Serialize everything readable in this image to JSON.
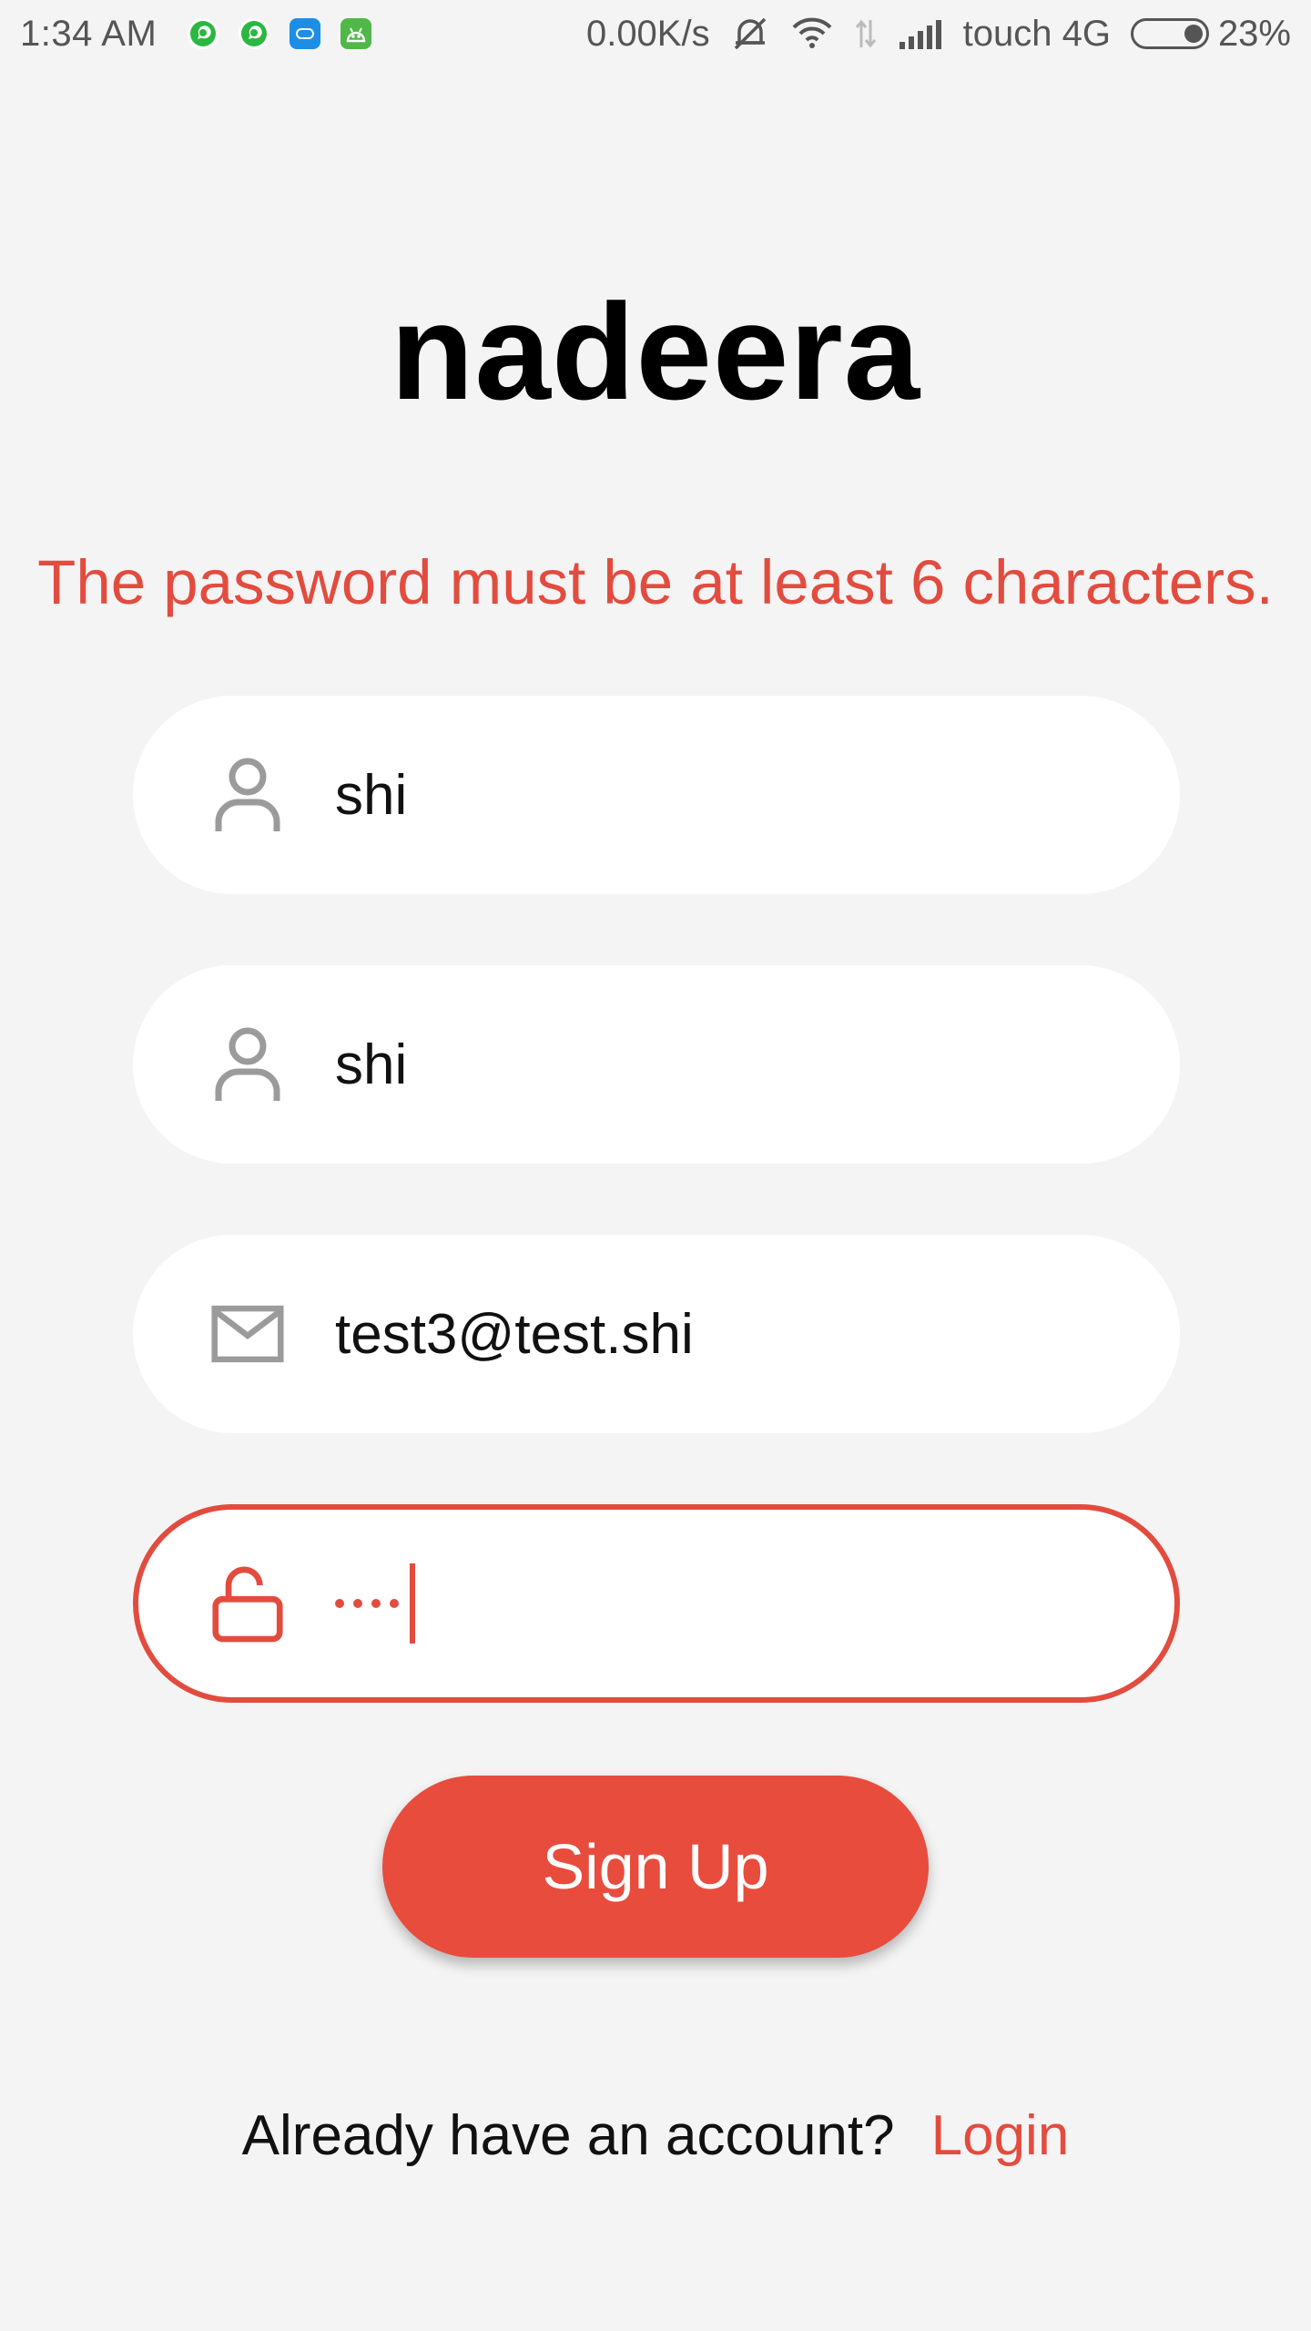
{
  "status_bar": {
    "time": "1:34  AM",
    "network_speed": "0.00K/s",
    "carrier": "touch 4G",
    "battery_percent": "23%",
    "notification_icons": [
      "whatsapp-icon",
      "whatsapp-icon",
      "mi-app-icon",
      "android-app-icon"
    ],
    "system_icons": [
      "mute-bell-icon",
      "wifi-icon",
      "data-transfer-icon",
      "signal-icon"
    ]
  },
  "app": {
    "title": "nadeera"
  },
  "error": {
    "message": "The password must be at least 6 characters."
  },
  "form": {
    "first_name": {
      "value": "shi",
      "icon": "person-icon"
    },
    "last_name": {
      "value": "shi",
      "icon": "person-icon"
    },
    "email": {
      "value": "test3@test.shi",
      "icon": "mail-icon"
    },
    "password": {
      "masked_length": 4,
      "icon": "unlock-icon"
    },
    "submit_label": "Sign Up"
  },
  "footer": {
    "prompt": "Already have an account?",
    "link_label": "Login"
  },
  "colors": {
    "accent": "#e84c3d",
    "error": "#e24c3f",
    "background": "#f4f4f4",
    "field": "#ffffff",
    "icon_gray": "#9b9b9b"
  }
}
